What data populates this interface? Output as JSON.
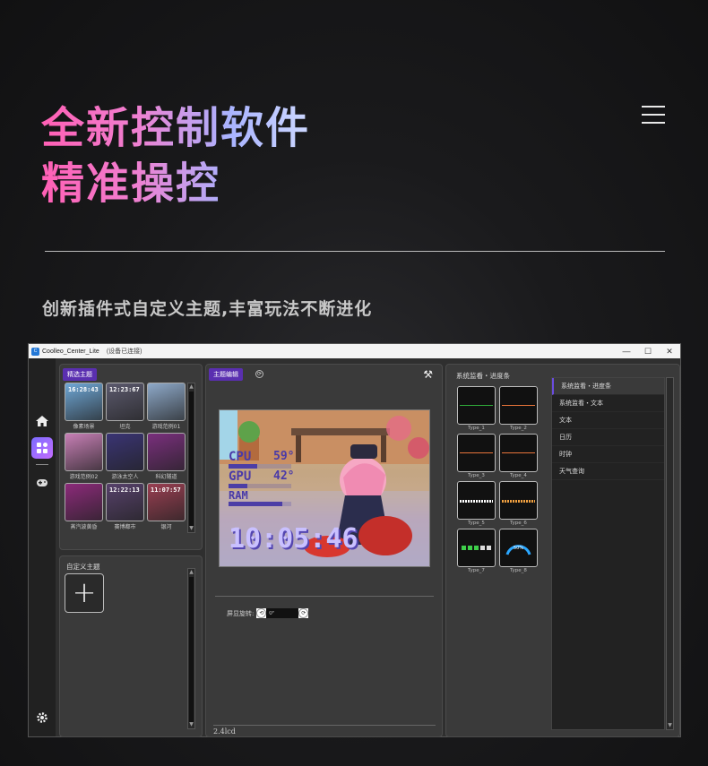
{
  "hero": {
    "line1": "全新控制软件",
    "line2": "精准操控",
    "subtitle": "创新插件式自定义主题,丰富玩法不断进化"
  },
  "window": {
    "title": "Coolleo_Center_Lite",
    "status": "(设备已连接)",
    "controls": [
      "—",
      "☐",
      "✕"
    ]
  },
  "sidebar": {
    "icons": [
      "home-icon",
      "theme-icon",
      "gamepad-icon",
      "settings-icon"
    ]
  },
  "featured": {
    "tag": "精选主题",
    "themes": [
      {
        "caption": "像素场景",
        "color": "#6fa7d6",
        "clock": "16:28:43"
      },
      {
        "caption": "坦克",
        "color": "#5c5a6e",
        "clock": "12:23:67"
      },
      {
        "caption": "游戏范例01",
        "color": "#8ea9c9",
        "clock": ""
      },
      {
        "caption": "游戏范例02",
        "color": "#c77fb5",
        "clock": ""
      },
      {
        "caption": "游泳太空人",
        "color": "#3a3474",
        "clock": ""
      },
      {
        "caption": "科幻隧道",
        "color": "#7a2f7d",
        "clock": ""
      },
      {
        "caption": "蒸汽波黄昏",
        "color": "#8c2a7a",
        "clock": ""
      },
      {
        "caption": "赛博都市",
        "color": "#57416b",
        "clock": "12:22:13"
      },
      {
        "caption": "银河",
        "color": "#9a3f52",
        "clock": "11:07:57"
      }
    ]
  },
  "custom": {
    "label": "自定义主题",
    "add": "+"
  },
  "editor": {
    "tag": "主题编辑",
    "preview": {
      "cpu_label": "CPU",
      "cpu_value": "59°",
      "gpu_label": "GPU",
      "gpu_value": "42°",
      "ram_label": "RAM",
      "cpu_level": 0.45,
      "gpu_level": 0.3,
      "ram_level": 0.85,
      "time": "10:05:46"
    },
    "rotation_label": "屏显旋转:",
    "rotation_value": "0°",
    "footer": "2.4lcd"
  },
  "monitor": {
    "label": "系统监看・进度条",
    "widgets": [
      {
        "caption": "Type_1",
        "line": "#2faa3a"
      },
      {
        "caption": "Type_2",
        "line": "#e8743a"
      },
      {
        "caption": "Type_3",
        "line": "#e8743a"
      },
      {
        "caption": "Type_4",
        "line": "#e8743a"
      },
      {
        "caption": "Type_5",
        "line": "#ffffff"
      },
      {
        "caption": "Type_6",
        "line": "#f0a040"
      },
      {
        "caption": "Type_7",
        "line": "#3ecf4a"
      },
      {
        "caption": "Type_8",
        "line": "#2aa7ff",
        "gauge": "50%"
      }
    ],
    "categories": [
      "系统监看・进度条",
      "系统监看・文本",
      "文本",
      "日历",
      "时钟",
      "天气查询"
    ]
  }
}
